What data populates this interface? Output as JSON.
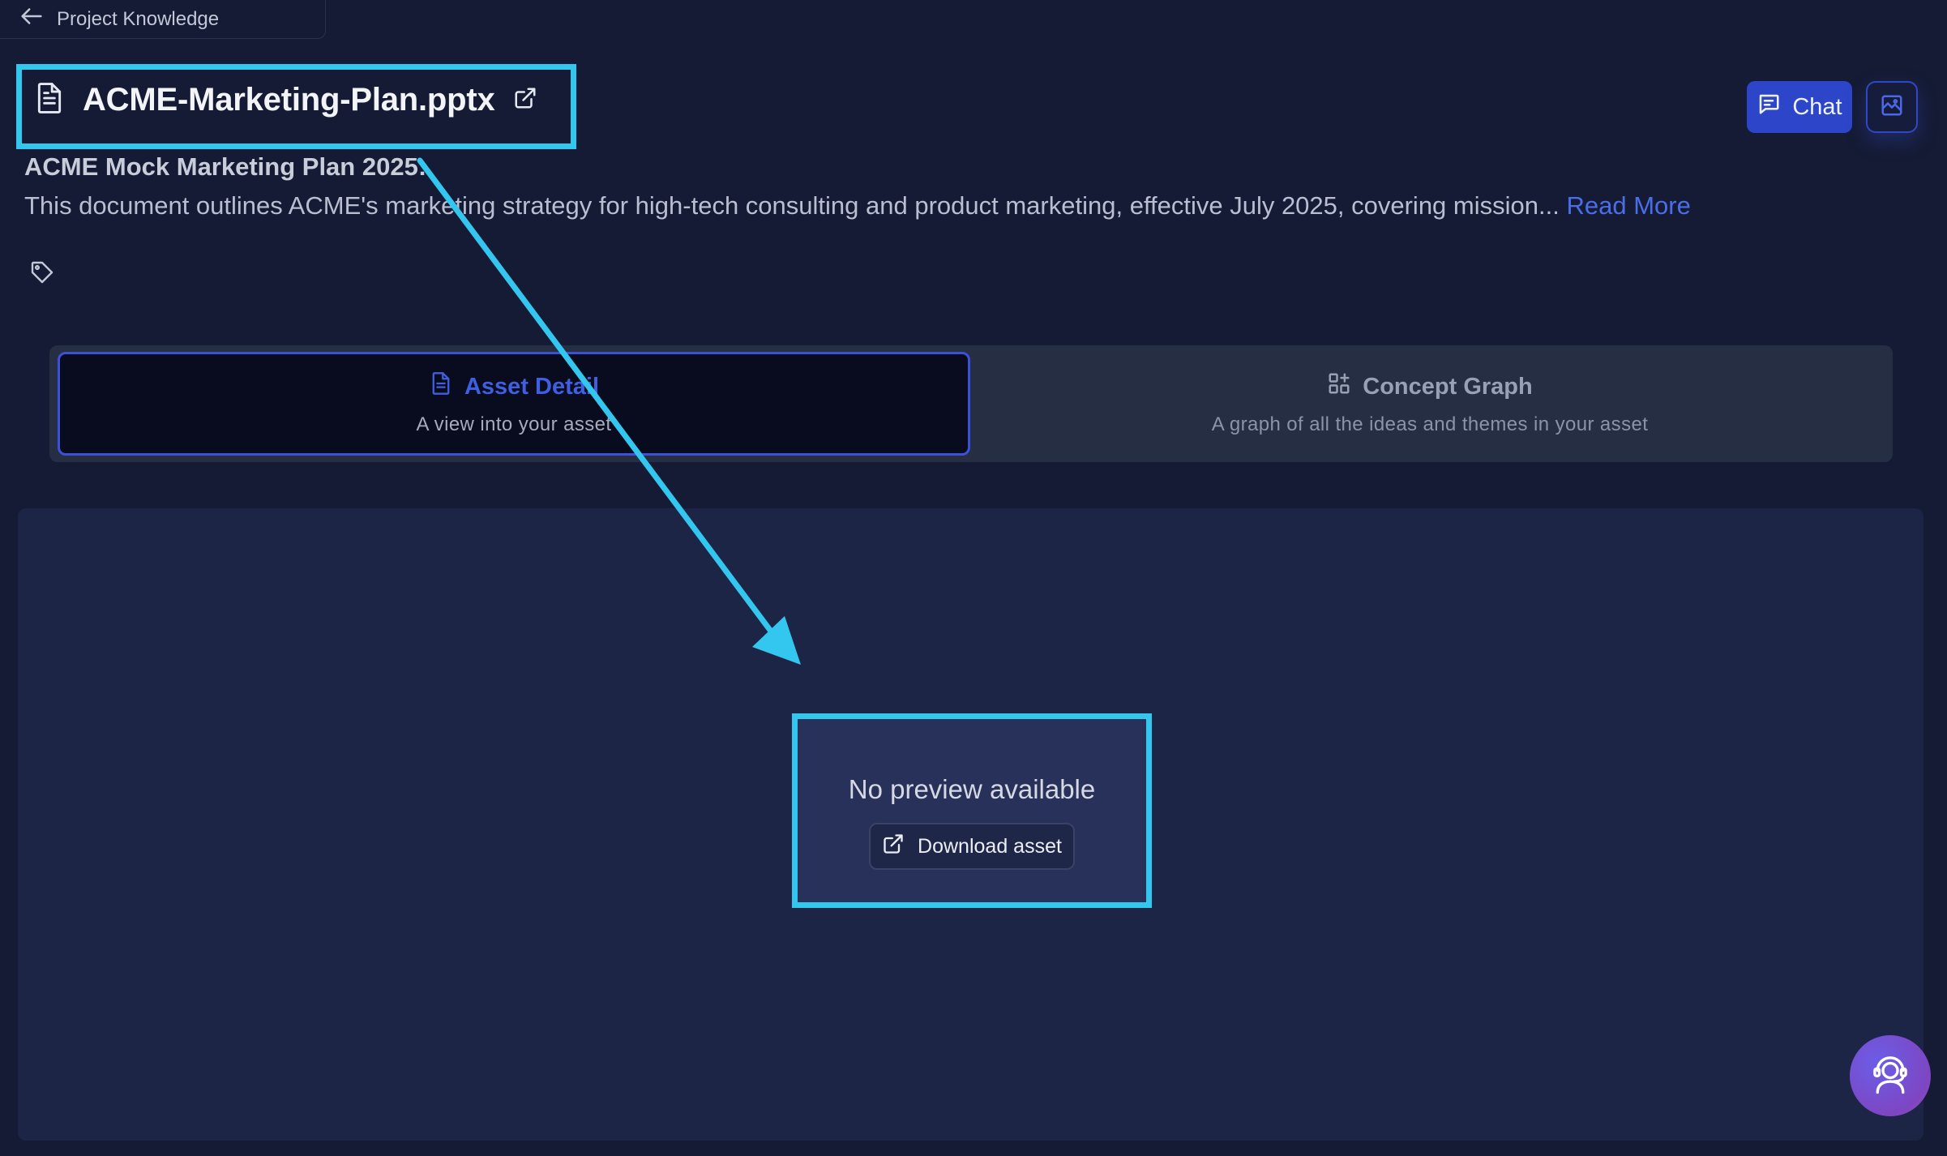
{
  "nav": {
    "back_label": "Project Knowledge"
  },
  "asset": {
    "file_name": "ACME-Marketing-Plan.pptx",
    "subtitle": "ACME Mock Marketing Plan 2025:",
    "description": "This document outlines ACME's marketing strategy for high-tech consulting and product marketing, effective July 2025, covering mission...",
    "read_more_label": "Read More"
  },
  "header": {
    "chat_label": "Chat"
  },
  "tabs": [
    {
      "label": "Asset Detail",
      "description": "A view into your asset",
      "active": true
    },
    {
      "label": "Concept Graph",
      "description": "A graph of all the ideas and themes in your asset",
      "active": false
    }
  ],
  "preview": {
    "empty_message": "No preview available",
    "download_label": "Download asset"
  },
  "icons": {
    "back": "arrow-left-icon",
    "document": "document-icon",
    "external_link": "external-link-icon",
    "chat": "chat-bubble-icon",
    "image": "image-icon",
    "tag": "tag-icon",
    "concept_graph": "grid-plus-icon",
    "support": "support-agent-icon"
  },
  "colors": {
    "background": "#151b34",
    "accent": "#2d46c9",
    "link": "#4a6ee8",
    "highlight": "#33c7f0",
    "panel": "#1c2545"
  }
}
